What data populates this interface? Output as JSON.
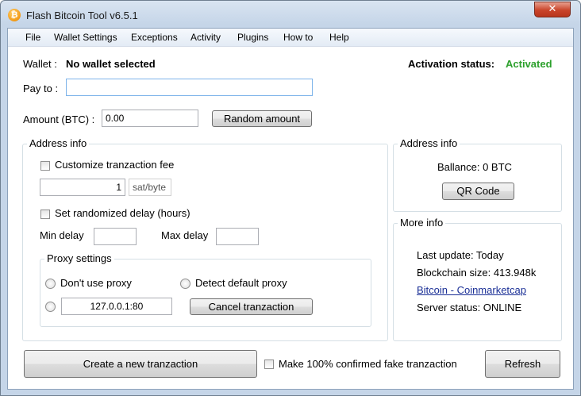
{
  "window": {
    "title": "Flash Bitcoin Tool v6.5.1",
    "close_glyph": "✕",
    "icon_glyph": "₿"
  },
  "menu": [
    "File",
    "Wallet Settings",
    "Exceptions",
    "Activity",
    "Plugins",
    "How to",
    "Help"
  ],
  "wallet": {
    "label": "Wallet :",
    "value": "No wallet selected"
  },
  "activation": {
    "label": "Activation status:",
    "value": "Activated",
    "value_color": "#2ca02c"
  },
  "pay_to": {
    "label": "Pay to :",
    "value": ""
  },
  "amount": {
    "label": "Amount (BTC) :",
    "value": "0.00",
    "random_button": "Random amount"
  },
  "address_info": {
    "title": "Address info",
    "customize_fee": {
      "label": "Customize tranzaction fee",
      "checked": false
    },
    "fee_value": "1",
    "fee_unit": "sat/byte",
    "randomized_delay": {
      "label": "Set randomized delay (hours)",
      "checked": false
    },
    "min_delay": {
      "label": "Min delay",
      "value": ""
    },
    "max_delay": {
      "label": "Max delay",
      "value": ""
    },
    "proxy": {
      "title": "Proxy settings",
      "dont_use": "Don't use proxy",
      "detect_default": "Detect default proxy",
      "custom_value": "127.0.0.1:80",
      "cancel_button": "Cancel tranzaction"
    }
  },
  "address_info_right": {
    "title": "Address info",
    "balance": "Ballance: 0 BTC",
    "qr_button": "QR Code"
  },
  "more_info": {
    "title": "More info",
    "last_update": "Last update:  Today",
    "blockchain_size": "Blockchain size:  413.948k",
    "link": "Bitcoin - Coinmarketcap",
    "server_status": "Server status:  ONLINE"
  },
  "bottom": {
    "create_button": "Create a new tranzaction",
    "fake_checkbox": {
      "label": "Make 100% confirmed fake tranzaction",
      "checked": false
    },
    "refresh_button": "Refresh"
  }
}
